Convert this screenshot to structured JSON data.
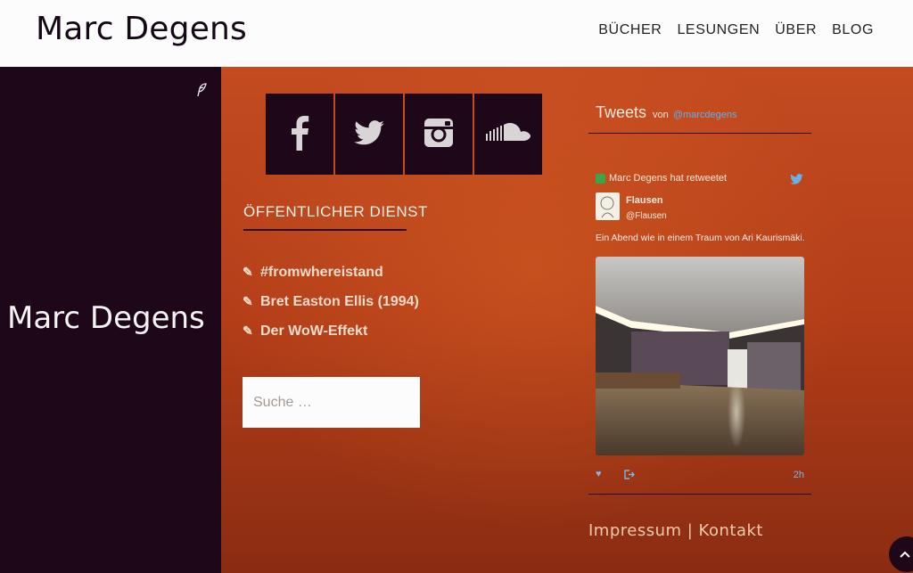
{
  "header": {
    "brand": "Marc Degens",
    "nav": [
      "BÜCHER",
      "LESUNGEN",
      "ÜBER",
      "BLOG"
    ]
  },
  "left_panel": {
    "brand": "Marc Degens",
    "icon": "feather-icon"
  },
  "social": {
    "icons": [
      "facebook-icon",
      "twitter-icon",
      "instagram-icon",
      "soundcloud-icon"
    ]
  },
  "section": {
    "title": "ÖFFENTLICHER DIENST",
    "posts": [
      "#fromwhereistand",
      "Bret Easton Ellis (1994)",
      "Der WoW-Effekt"
    ]
  },
  "search": {
    "placeholder": "Suche …"
  },
  "twitter": {
    "title": "Tweets",
    "von": "von",
    "handle": "@marcdegens",
    "retweet_text": "Marc Degens hat retweetet",
    "tweet": {
      "name": "Flausen",
      "username": "@Flausen",
      "text": "Ein Abend wie in einem Traum von Ari Kaurismäki.",
      "time": "2h"
    }
  },
  "footer": {
    "links": "Impressum | Kontakt"
  },
  "colors": {
    "dark": "#1d0718",
    "orange": "#b8401a",
    "twitter_blue": "#66aee0"
  }
}
